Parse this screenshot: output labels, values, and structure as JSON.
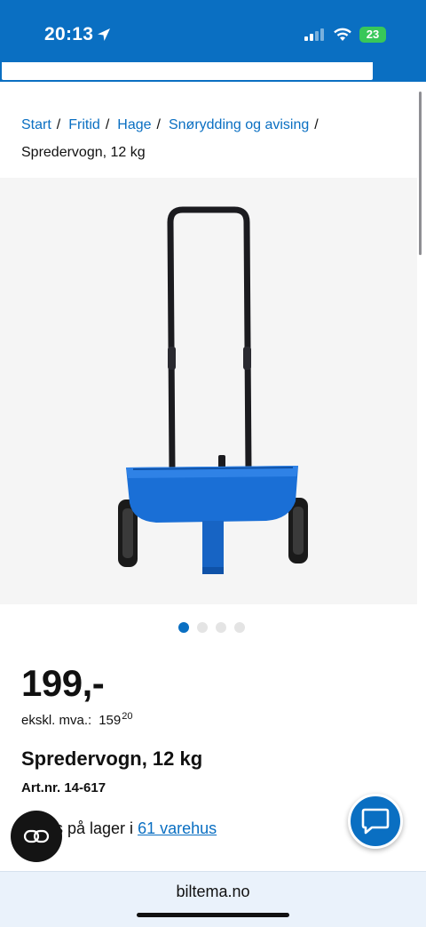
{
  "status_bar": {
    "time": "20:13",
    "battery": "23"
  },
  "breadcrumb": {
    "items": [
      "Start",
      "Fritid",
      "Hage",
      "Snørydding og avising"
    ],
    "separator": "/",
    "current": "Spredervogn, 12 kg"
  },
  "gallery": {
    "image_count": 4,
    "active_index": 0
  },
  "product": {
    "price": "199,-",
    "ex_vat_label": "ekskl. mva.:",
    "ex_vat_whole": "159",
    "ex_vat_cents": "20",
    "title": "Spredervogn, 12 kg",
    "article_number": "Art.nr. 14-617",
    "stock_prefix": "s på lager i",
    "stock_link": "61 varehus"
  },
  "browser": {
    "url": "biltema.no"
  },
  "icons": {
    "chat": "chat-bubble-icon",
    "cookie": "cookie-settings-icon",
    "location": "location-arrow-icon"
  },
  "colors": {
    "brand_blue": "#0a6fc2",
    "product_blue": "#1a6fd6",
    "battery_green": "#38c759"
  }
}
